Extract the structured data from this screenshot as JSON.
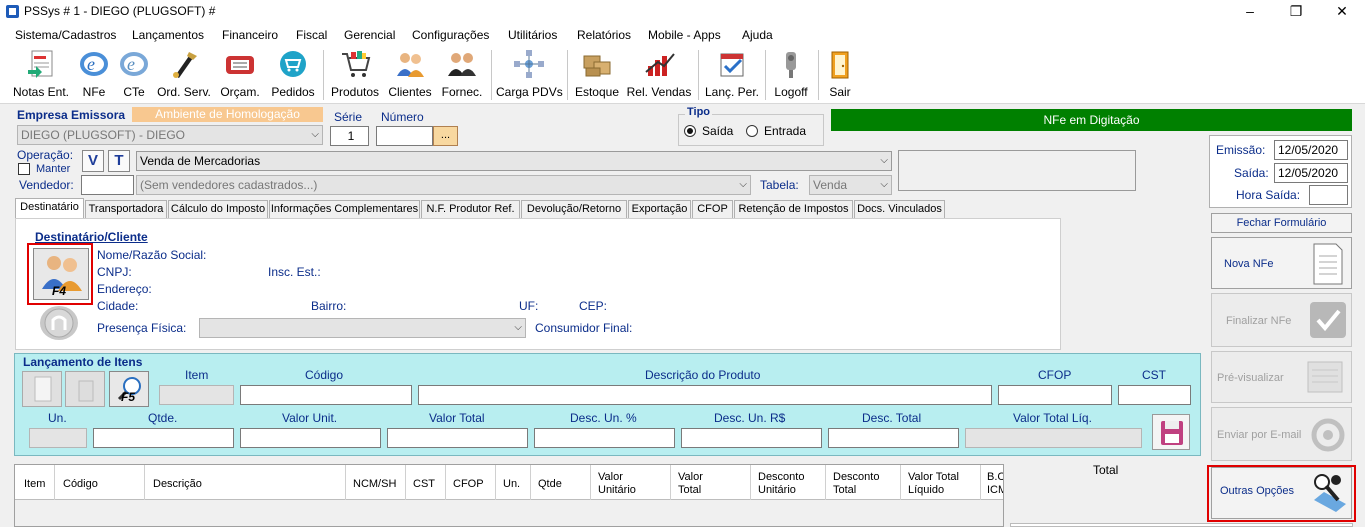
{
  "window": {
    "title": "PSSys # 1 - DIEGO (PLUGSOFT) #"
  },
  "menu": [
    "Sistema/Cadastros",
    "Lançamentos",
    "Financeiro",
    "Fiscal",
    "Gerencial",
    "Configurações",
    "Utilitários",
    "Relatórios",
    "Mobile - Apps",
    "Ajuda"
  ],
  "toolbar": [
    {
      "label": "Notas Ent.",
      "icon": "notas-entrada-icon"
    },
    {
      "label": "NFe",
      "icon": "nfe-icon"
    },
    {
      "label": "CTe",
      "icon": "cte-icon"
    },
    {
      "label": "Ord. Serv.",
      "icon": "ordem-servico-icon"
    },
    {
      "label": "Orçam.",
      "icon": "orcamento-icon"
    },
    {
      "label": "Pedidos",
      "icon": "pedidos-icon"
    },
    {
      "label": "Produtos",
      "icon": "produtos-icon"
    },
    {
      "label": "Clientes",
      "icon": "clientes-icon"
    },
    {
      "label": "Fornec.",
      "icon": "fornecedores-icon"
    },
    {
      "label": "Carga PDVs",
      "icon": "carga-pdvs-icon"
    },
    {
      "label": "Estoque",
      "icon": "estoque-icon"
    },
    {
      "label": "Rel. Vendas",
      "icon": "relatorio-vendas-icon"
    },
    {
      "label": "Lanç. Per.",
      "icon": "lancamento-periodico-icon"
    },
    {
      "label": "Logoff",
      "icon": "logoff-icon"
    },
    {
      "label": "Sair",
      "icon": "sair-icon"
    }
  ],
  "header": {
    "empresa_label": "Empresa Emissora",
    "ambiente": "Ambiente de Homologação",
    "empresa_value": "DIEGO  (PLUGSOFT) - DIEGO",
    "serie_label": "Série",
    "serie_value": "1",
    "numero_label": "Número",
    "numero_value": "",
    "numero_btn": "...",
    "tipo_label": "Tipo",
    "tipo_saida": "Saída",
    "tipo_entrada": "Entrada",
    "status": "NFe em Digitação",
    "operacao_label": "Operação:",
    "manter_label": "Manter",
    "btn_v": "V",
    "btn_t": "T",
    "operacao_value": "Venda de Mercadorias",
    "vendedor_label": "Vendedor:",
    "vendedor_code": "",
    "vendedor_value": "(Sem vendedores cadastrados...)",
    "tabela_label": "Tabela:",
    "tabela_value": "Venda",
    "emissao_label": "Emissão:",
    "emissao_value": "12/05/2020",
    "saida_label": "Saída:",
    "saida_value": "12/05/2020",
    "hora_saida_label": "Hora Saída:",
    "hora_saida_value": ""
  },
  "tabs": [
    "Destinatário",
    "Transportadora",
    "Cálculo do Imposto",
    "Informações Complementares",
    "N.F. Produtor Ref.",
    "Devolução/Retorno",
    "Exportação",
    "CFOP",
    "Retenção de Impostos",
    "Docs. Vinculados"
  ],
  "destinatario": {
    "title": "Destinatário/Cliente",
    "btn_key": "F4",
    "nome_label": "Nome/Razão Social:",
    "cnpj_label": "CNPJ:",
    "insc_label": "Insc. Est.:",
    "endereco_label": "Endereço:",
    "cidade_label": "Cidade:",
    "bairro_label": "Bairro:",
    "uf_label": "UF:",
    "cep_label": "CEP:",
    "presenca_label": "Presença Física:",
    "presenca_value": "",
    "consumidor_label": "Consumidor Final:"
  },
  "itens": {
    "title": "Lançamento de Itens",
    "search_key": "F5",
    "item_label": "Item",
    "codigo_label": "Código",
    "descricao_label": "Descrição do Produto",
    "cfop_label": "CFOP",
    "cst_label": "CST",
    "un_label": "Un.",
    "qtde_label": "Qtde.",
    "valor_unit_label": "Valor Unit.",
    "valor_total_label": "Valor Total",
    "desc_un_pct_label": "Desc. Un. %",
    "desc_un_rs_label": "Desc. Un. R$",
    "desc_total_label": "Desc. Total",
    "valor_total_liq_label": "Valor Total Líq."
  },
  "grid": {
    "columns": [
      "Item",
      "Código",
      "Descrição",
      "NCM/SH",
      "CST",
      "CFOP",
      "Un.",
      "Qtde",
      "Valor\nUnitário",
      "Valor\nTotal",
      "Desconto\nUnitário",
      "Desconto\nTotal",
      "Valor Total\nLíquido",
      "B.C\nICM"
    ]
  },
  "total_label": "Total",
  "side": {
    "fechar": "Fechar Formulário",
    "nova": "Nova NFe",
    "finalizar": "Finalizar NFe",
    "previsualizar": "Pré-visualizar",
    "enviar": "Enviar por E-mail",
    "outras": "Outras Opções"
  },
  "colors": {
    "status_bg": "#008000",
    "ambiente_bg": "#f8c890",
    "itens_bg": "#b8eef0",
    "label_blue": "#0b2d8a",
    "highlight": "#e00000"
  }
}
